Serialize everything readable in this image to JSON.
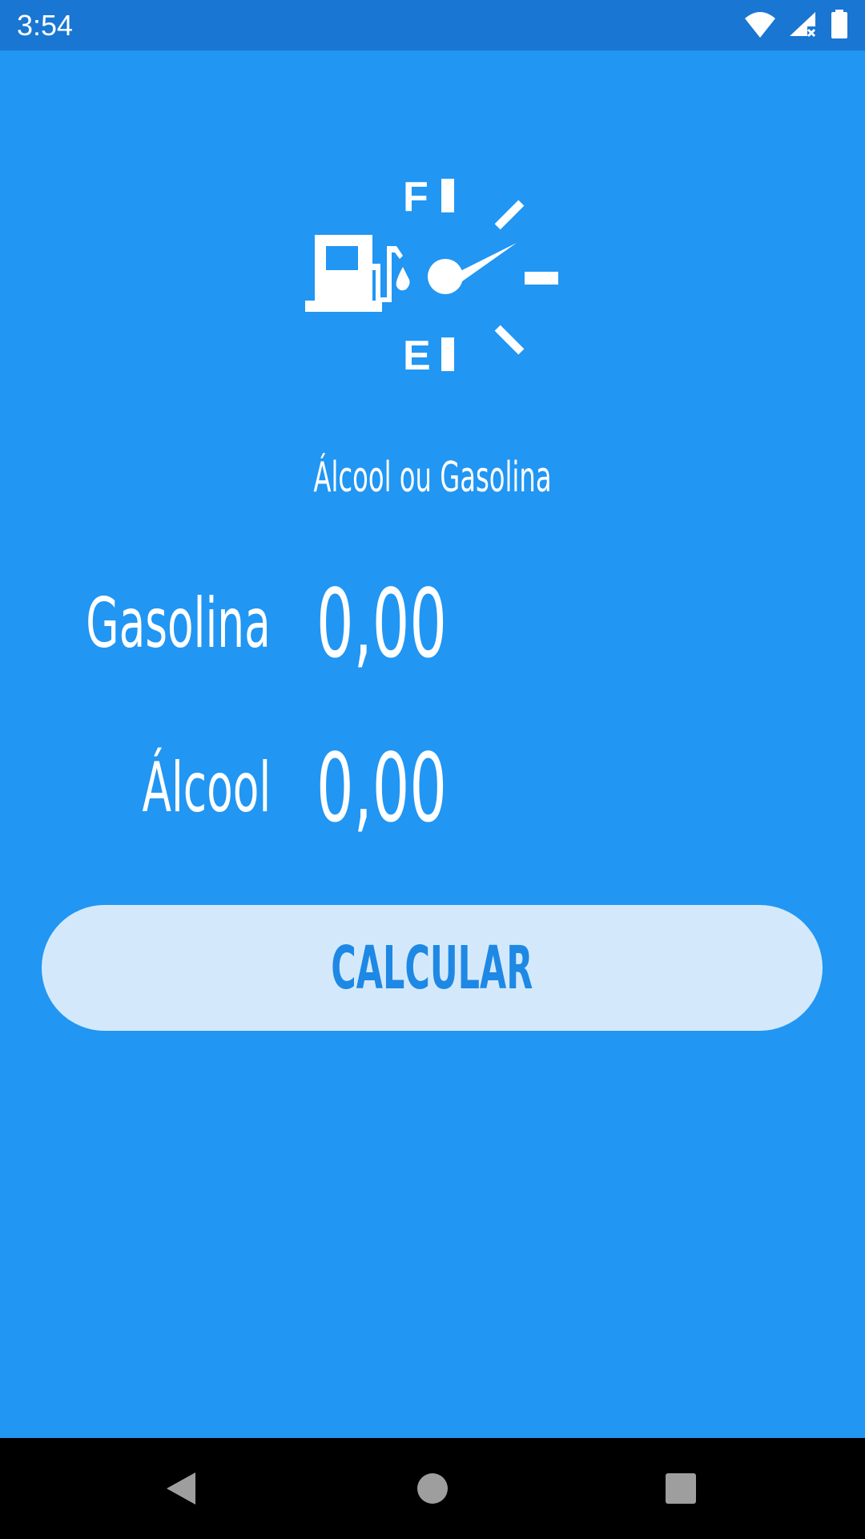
{
  "status_bar": {
    "time": "3:54",
    "icons": [
      "wifi-icon",
      "cell-signal-icon",
      "battery-icon"
    ]
  },
  "header": {
    "logo_icon": "fuel-gauge-icon",
    "gauge_full_label": "F",
    "gauge_empty_label": "E",
    "subtitle": "Álcool ou Gasolina"
  },
  "form": {
    "gasolina_label": "Gasolina",
    "gasolina_placeholder": "0,00",
    "alcool_label": "Álcool",
    "alcool_placeholder": "0,00"
  },
  "actions": {
    "calculate_label": "CALCULAR"
  },
  "navigation": {
    "buttons": [
      "back-icon",
      "home-icon",
      "recents-icon"
    ]
  },
  "colors": {
    "background": "#2196F3",
    "status_bar": "#1976D2",
    "button_bg": "#D3E9FB",
    "button_text": "#1E88E5",
    "text": "#FFFFFF",
    "nav_bar": "#000000"
  }
}
